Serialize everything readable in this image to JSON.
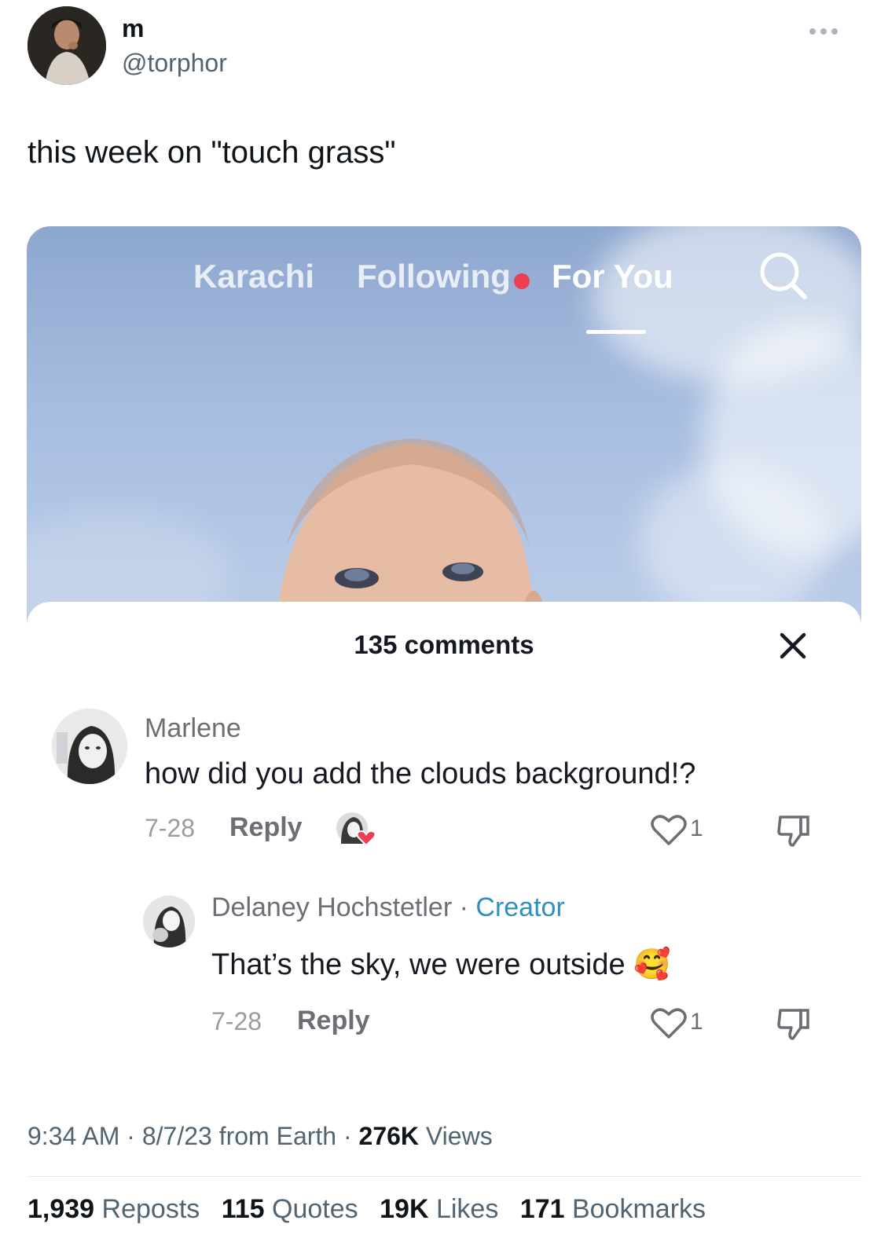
{
  "tweet": {
    "author_name": "m",
    "author_handle": "@torphor",
    "text": "this week on \"touch grass\"",
    "time": "9:34 AM",
    "date": "8/7/23",
    "source": "from Earth",
    "views_count": "276K",
    "views_label": "Views",
    "stats": {
      "reposts_count": "1,939",
      "reposts_label": "Reposts",
      "quotes_count": "115",
      "quotes_label": "Quotes",
      "likes_count": "19K",
      "likes_label": "Likes",
      "bookmarks_count": "171",
      "bookmarks_label": "Bookmarks"
    }
  },
  "embedded": {
    "tabs": [
      {
        "label": "Karachi"
      },
      {
        "label": "Following"
      },
      {
        "label": "For You"
      }
    ],
    "active_tab": "For You",
    "comments_header": "135 comments",
    "comments": [
      {
        "author": "Marlene",
        "text": "how did you add the clouds background!?",
        "date": "7-28",
        "reply_label": "Reply",
        "likes": "1"
      },
      {
        "author": "Delaney Hochstetler",
        "separator": "·",
        "badge": "Creator",
        "text": "That’s the sky, we were outside",
        "emoji": "🥰",
        "date": "7-28",
        "reply_label": "Reply",
        "likes": "1"
      }
    ]
  },
  "colors": {
    "accent_creator": "#2f8fbf",
    "notification_dot": "#ec3f52",
    "heart_badge": "#ec3f52"
  },
  "icons": [
    "more-icon",
    "search-icon",
    "close-icon",
    "heart-outline-icon",
    "dislike-icon",
    "heart-badge-icon"
  ]
}
